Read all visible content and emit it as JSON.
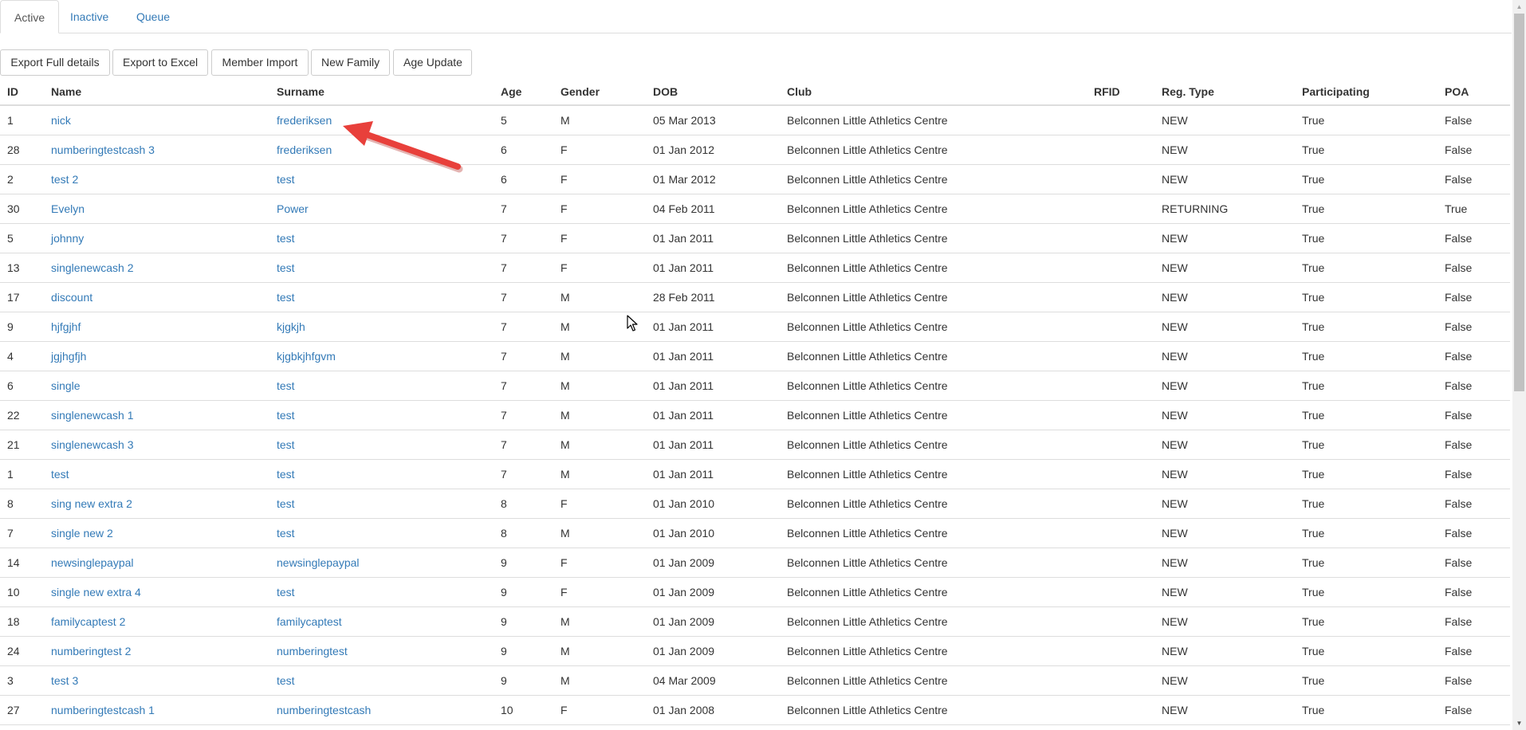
{
  "tabs": [
    {
      "label": "Active",
      "active": true
    },
    {
      "label": "Inactive",
      "active": false
    },
    {
      "label": "Queue",
      "active": false
    }
  ],
  "toolbar": {
    "export_full_label": "Export Full details",
    "export_excel_label": "Export to Excel",
    "member_import_label": "Member Import",
    "new_family_label": "New Family",
    "age_update_label": "Age Update"
  },
  "table": {
    "headers": [
      "ID",
      "Name",
      "Surname",
      "Age",
      "Gender",
      "DOB",
      "Club",
      "RFID",
      "Reg. Type",
      "Participating",
      "POA"
    ],
    "rows": [
      [
        "1",
        "nick",
        "frederiksen",
        "5",
        "M",
        "05 Mar 2013",
        "Belconnen Little Athletics Centre",
        "",
        "NEW",
        "True",
        "False"
      ],
      [
        "28",
        "numberingtestcash 3",
        "frederiksen",
        "6",
        "F",
        "01 Jan 2012",
        "Belconnen Little Athletics Centre",
        "",
        "NEW",
        "True",
        "False"
      ],
      [
        "2",
        "test 2",
        "test",
        "6",
        "F",
        "01 Mar 2012",
        "Belconnen Little Athletics Centre",
        "",
        "NEW",
        "True",
        "False"
      ],
      [
        "30",
        "Evelyn",
        "Power",
        "7",
        "F",
        "04 Feb 2011",
        "Belconnen Little Athletics Centre",
        "",
        "RETURNING",
        "True",
        "True"
      ],
      [
        "5",
        "johnny",
        "test",
        "7",
        "F",
        "01 Jan 2011",
        "Belconnen Little Athletics Centre",
        "",
        "NEW",
        "True",
        "False"
      ],
      [
        "13",
        "singlenewcash 2",
        "test",
        "7",
        "F",
        "01 Jan 2011",
        "Belconnen Little Athletics Centre",
        "",
        "NEW",
        "True",
        "False"
      ],
      [
        "17",
        "discount",
        "test",
        "7",
        "M",
        "28 Feb 2011",
        "Belconnen Little Athletics Centre",
        "",
        "NEW",
        "True",
        "False"
      ],
      [
        "9",
        "hjfgjhf",
        "kjgkjh",
        "7",
        "M",
        "01 Jan 2011",
        "Belconnen Little Athletics Centre",
        "",
        "NEW",
        "True",
        "False"
      ],
      [
        "4",
        "jgjhgfjh",
        "kjgbkjhfgvm",
        "7",
        "M",
        "01 Jan 2011",
        "Belconnen Little Athletics Centre",
        "",
        "NEW",
        "True",
        "False"
      ],
      [
        "6",
        "single",
        "test",
        "7",
        "M",
        "01 Jan 2011",
        "Belconnen Little Athletics Centre",
        "",
        "NEW",
        "True",
        "False"
      ],
      [
        "22",
        "singlenewcash 1",
        "test",
        "7",
        "M",
        "01 Jan 2011",
        "Belconnen Little Athletics Centre",
        "",
        "NEW",
        "True",
        "False"
      ],
      [
        "21",
        "singlenewcash 3",
        "test",
        "7",
        "M",
        "01 Jan 2011",
        "Belconnen Little Athletics Centre",
        "",
        "NEW",
        "True",
        "False"
      ],
      [
        "1",
        "test",
        "test",
        "7",
        "M",
        "01 Jan 2011",
        "Belconnen Little Athletics Centre",
        "",
        "NEW",
        "True",
        "False"
      ],
      [
        "8",
        "sing new extra 2",
        "test",
        "8",
        "F",
        "01 Jan 2010",
        "Belconnen Little Athletics Centre",
        "",
        "NEW",
        "True",
        "False"
      ],
      [
        "7",
        "single new 2",
        "test",
        "8",
        "M",
        "01 Jan 2010",
        "Belconnen Little Athletics Centre",
        "",
        "NEW",
        "True",
        "False"
      ],
      [
        "14",
        "newsinglepaypal",
        "newsinglepaypal",
        "9",
        "F",
        "01 Jan 2009",
        "Belconnen Little Athletics Centre",
        "",
        "NEW",
        "True",
        "False"
      ],
      [
        "10",
        "single new extra 4",
        "test",
        "9",
        "F",
        "01 Jan 2009",
        "Belconnen Little Athletics Centre",
        "",
        "NEW",
        "True",
        "False"
      ],
      [
        "18",
        "familycaptest 2",
        "familycaptest",
        "9",
        "M",
        "01 Jan 2009",
        "Belconnen Little Athletics Centre",
        "",
        "NEW",
        "True",
        "False"
      ],
      [
        "24",
        "numberingtest 2",
        "numberingtest",
        "9",
        "M",
        "01 Jan 2009",
        "Belconnen Little Athletics Centre",
        "",
        "NEW",
        "True",
        "False"
      ],
      [
        "3",
        "test 3",
        "test",
        "9",
        "M",
        "04 Mar 2009",
        "Belconnen Little Athletics Centre",
        "",
        "NEW",
        "True",
        "False"
      ],
      [
        "27",
        "numberingtestcash 1",
        "numberingtestcash",
        "10",
        "F",
        "01 Jan 2008",
        "Belconnen Little Athletics Centre",
        "",
        "NEW",
        "True",
        "False"
      ]
    ]
  },
  "colors": {
    "link": "#337ab7",
    "text": "#333333",
    "border": "#dddddd",
    "annotation_arrow": "#e8403b"
  },
  "icons": {
    "scroll_up": "triangle-up-icon",
    "scroll_down": "triangle-down-icon",
    "cursor": "mouse-pointer-icon",
    "annotation": "red-arrow-icon"
  }
}
